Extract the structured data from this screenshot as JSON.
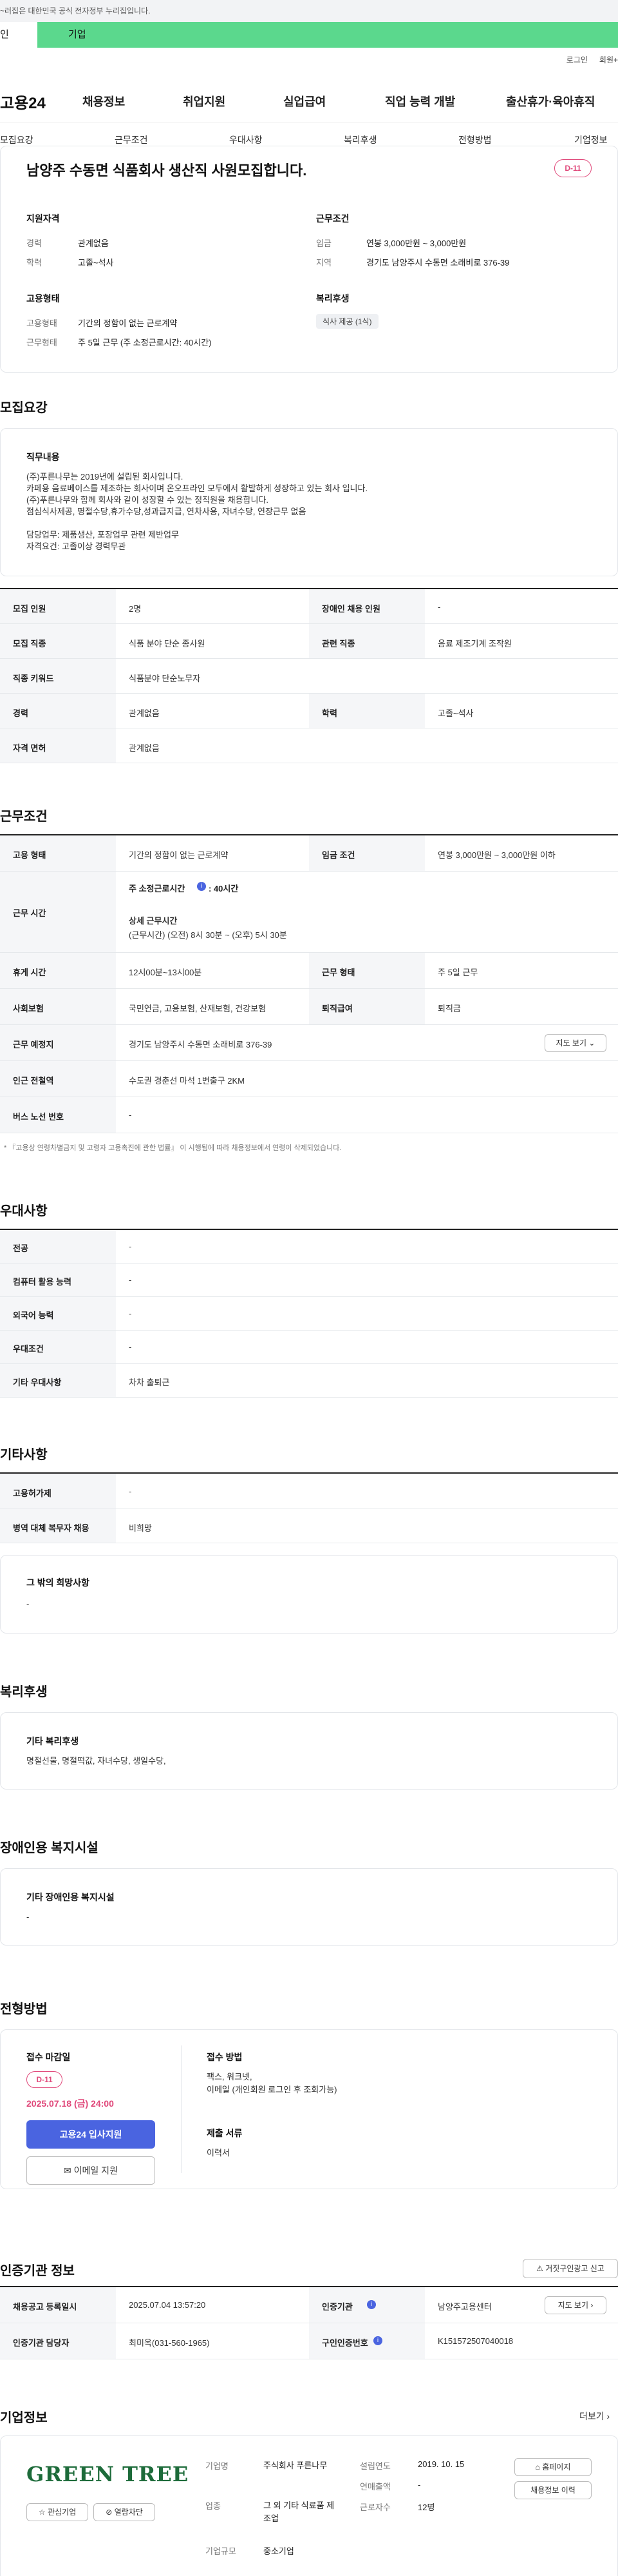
{
  "gov_notice": "~러집은 대한민국 공식 전자정부 누리집입니다.",
  "user_tabs": {
    "person": "인",
    "corp": "기업"
  },
  "util": {
    "login": "로그인",
    "join": "회원+"
  },
  "nav": {
    "logo": "고용24",
    "menu": [
      "채용정보",
      "취업지원",
      "실업급여",
      "직업 능력 개발",
      "출산휴가·육아휴직"
    ]
  },
  "subnav": [
    "모집요강",
    "근무조건",
    "우대사항",
    "복리후생",
    "전형방법",
    "기업정보"
  ],
  "summary": {
    "title": "남양주 수동면 식품회사 생산직 사원모집합니다.",
    "dday": "D-11",
    "qual": {
      "title": "지원자격",
      "career_k": "경력",
      "career_v": "관계없음",
      "edu_k": "학력",
      "edu_v": "고졸~석사"
    },
    "work": {
      "title": "근무조건",
      "wage_k": "임금",
      "wage_v": "연봉 3,000만원 ~ 3,000만원",
      "area_k": "지역",
      "area_v": "경기도 남양주시 수동면 소래비로 376-39"
    },
    "employ": {
      "title": "고용형태",
      "type_k": "고용형태",
      "type_v": "기간의 정함이 없는 근로계약",
      "form_k": "근무형태",
      "form_v": "주 5일 근무 (주 소정근로시간: 40시간)"
    },
    "welfare": {
      "title": "복리후생",
      "chip": "식사 제공 (1식)"
    }
  },
  "recruit": {
    "section": "모집요강",
    "duty_title": "직무내용",
    "duty_lines": [
      "(주)푸른나무는 2019년에 설립된 회사입니다.",
      "카페용 음료베이스를 제조하는 회사이며 온오프라인 모두에서 활발하게 성장하고 있는 회사 입니다.",
      "(주)푸른나무와 함께 회사와 같이 성장할 수 있는 정직원을 채용합니다.",
      "점심식사제공, 명절수당,휴가수당,성과급지급, 연차사용, 자녀수당, 연장근무 없음",
      "",
      "담당업무: 제품생산, 포장업무 관련 제반업무",
      "자격요건: 고졸이상 경력무관"
    ],
    "rows": [
      {
        "k1": "모집 인원",
        "v1": "2명",
        "k2": "장애인 채용 인원",
        "v2": "-"
      },
      {
        "k1": "모집 직종",
        "v1": "식품 분야 단순 종사원",
        "k2": "관련 직종",
        "v2": "음료 제조기계 조작원"
      },
      {
        "k1": "직종 키워드",
        "v1": "식품분야 단순노무자",
        "k2": "",
        "v2": ""
      },
      {
        "k1": "경력",
        "v1": "관계없음",
        "k2": "학력",
        "v2": "고졸~석사"
      },
      {
        "k1": "자격 면허",
        "v1": "관계없음",
        "k2": "",
        "v2": ""
      }
    ]
  },
  "cond": {
    "section": "근무조건",
    "emp_k": "고용 형태",
    "emp_v": "기간의 정함이 없는 근로계약",
    "wage_k": "임금 조건",
    "wage_v": "연봉 3,000만원 ~ 3,000만원 이하",
    "time_k": "근무 시간",
    "weekly": "주 소정근로시간",
    "weekly_v": ": 40시간",
    "detail_t": "상세 근무시간",
    "detail_v": "(근무시간) (오전) 8시 30분 ~ (오후) 5시 30분",
    "rest_k": "휴게 시간",
    "rest_v": "12시00분~13시00분",
    "form_k": "근무 형태",
    "form_v": "주 5일 근무",
    "ins_k": "사회보험",
    "ins_v": "국민연금, 고용보험, 산재보험, 건강보험",
    "ret_k": "퇴직급여",
    "ret_v": "퇴직금",
    "place_k": "근무 예정지",
    "place_v": "경기도 남양주시 수동면 소래비로 376-39",
    "map_btn": "지도 보기",
    "subway_k": "인근 전철역",
    "subway_v": "수도권 경춘선 마석 1번출구 2KM",
    "bus_k": "버스 노선 번호",
    "bus_v": "-",
    "note": "* 『고용상 연령차별금지 및 고령자 고용촉진에 관한 법률』 이 시행됨에 따라 채용정보에서 연령이 삭제되었습니다."
  },
  "pref": {
    "section": "우대사항",
    "rows": [
      {
        "k": "전공",
        "v": "-"
      },
      {
        "k": "컴퓨터 활용 능력",
        "v": "-"
      },
      {
        "k": "외국어 능력",
        "v": "-"
      },
      {
        "k": "우대조건",
        "v": "-"
      },
      {
        "k": "기타 우대사항",
        "v": "차차 출퇴근"
      }
    ]
  },
  "etc": {
    "section": "기타사항",
    "rows": [
      {
        "k": "고용허가제",
        "v": "-"
      },
      {
        "k": "병역 대체 복무자 채용",
        "v": "비희망"
      }
    ],
    "hope_t": "그 밖의 희망사항",
    "hope_v": "-"
  },
  "welfare": {
    "section": "복리후생",
    "box_t": "기타 복리후생",
    "box_v": "명절선물, 명절떡값, 자녀수당, 생일수당,"
  },
  "disabled": {
    "section": "장애인용 복지시설",
    "box_t": "기타 장애인용 복지시설",
    "box_v": "-"
  },
  "select": {
    "section": "전형방법",
    "deadline_t": "접수 마감일",
    "dday": "D-11",
    "deadline": "2025.07.18 (금) 24:00",
    "apply_btn": "고용24 입사지원",
    "email_btn": "이메일 지원",
    "method_t": "접수 방법",
    "method_v": "팩스, 워크넷,",
    "method_v2": "이메일 (개인회원 로그인 후 조회가능)",
    "docs_t": "제출 서류",
    "docs_v": "이력서"
  },
  "inst": {
    "section": "인증기관 정보",
    "report_btn": "거짓구인광고 신고",
    "rows": [
      {
        "k1": "채용공고 등록일시",
        "v1": "2025.07.04 13:57:20",
        "k2": "인증기관",
        "v2": "남양주고용센터",
        "btn": "지도 보기"
      },
      {
        "k1": "인증기관 담당자",
        "v1": "최미옥(031-560-1965)",
        "k2": "구인인증번호",
        "v2": "K151572507040018"
      }
    ]
  },
  "company": {
    "section": "기업정보",
    "more": "더보기",
    "logo": "GREEN TREE",
    "interest_btn": "관심기업",
    "block_btn": "열람차단",
    "name_k": "기업명",
    "name_v": "주식회사 푸른나무",
    "ind_k": "업종",
    "ind_v": "그 외 기타 식료품 제조업",
    "size_k": "기업규모",
    "size_v": "중소기업",
    "est_k": "설립연도",
    "est_v": "2019. 10. 15",
    "sales_k": "연매출액",
    "sales_v": "-",
    "emp_k": "근로자수",
    "emp_v": "12명",
    "home_btn": "홈페이지",
    "history_btn": "채용정보 이력"
  },
  "colors": {
    "corp_tab": "#5bd88d",
    "primary": "#4a64e0",
    "dday": "#e0487a"
  }
}
